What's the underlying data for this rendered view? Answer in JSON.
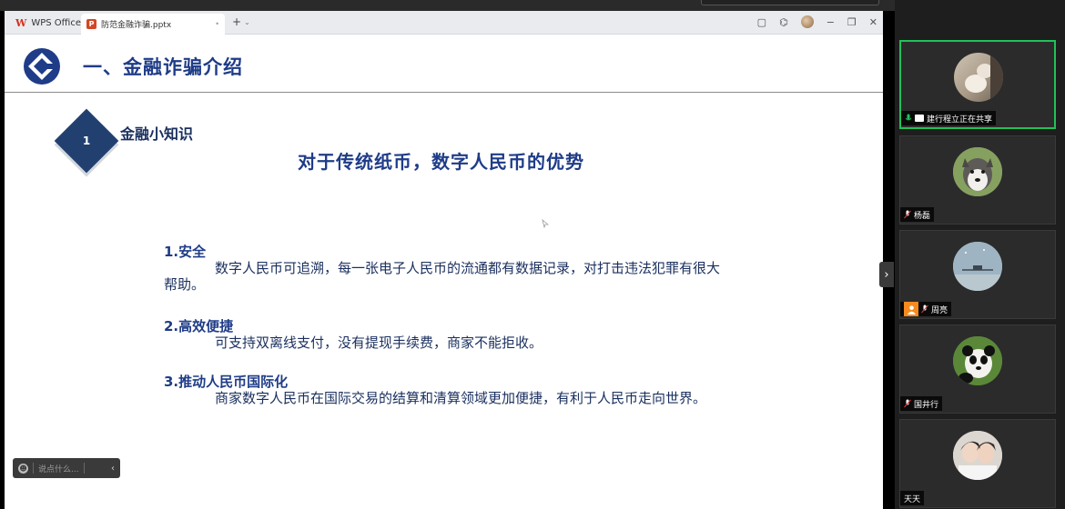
{
  "screen": {
    "app_tab_label": "WPS Office",
    "doc_tab_label": "防范金融诈骗.pptx",
    "doc_tab_modified": "•",
    "new_tab_symbol": "+",
    "tab_dropdown_symbol": "⌄",
    "window_buttons": {
      "box": "▢",
      "cube": "⌬",
      "minimize": "−",
      "restore": "❐",
      "close": "✕"
    }
  },
  "slide": {
    "header_title": "一、金融诈骗介绍",
    "badge_number": "1",
    "subtopic": "金融小知识",
    "main_title": "对于传统纸币，数字人民币的优势",
    "points": [
      {
        "title": "1.安全",
        "body": "数字人民币可追溯，每一张电子人民币的流通都有数据记录，对打击违法犯罪有很大帮助。"
      },
      {
        "title": "2.高效便捷",
        "body": "可支持双离线支付，没有提现手续费，商家不能拒收。"
      },
      {
        "title": "3.推动人民币国际化",
        "body": "商家数字人民币在国际交易的结算和清算领域更加便捷，有利于人民币走向世界。"
      }
    ]
  },
  "chat": {
    "placeholder": "说点什么...",
    "collapse_symbol": "‹"
  },
  "panel_toggle_symbol": "›",
  "participants": [
    {
      "name": "建行程立正在共享",
      "sharing": true,
      "avatar": "cat-avatar"
    },
    {
      "name": "杨磊",
      "sharing": false,
      "avatar": "husky-avatar"
    },
    {
      "name": "周亮",
      "sharing": false,
      "avatar": "sky-avatar"
    },
    {
      "name": "国井行",
      "sharing": false,
      "avatar": "panda-avatar"
    },
    {
      "name": "天天",
      "sharing": false,
      "avatar": "photo-avatar"
    }
  ],
  "colors": {
    "accent_blue": "#1f3c88",
    "active_green": "#21c15a",
    "wps_red": "#d7301f"
  }
}
